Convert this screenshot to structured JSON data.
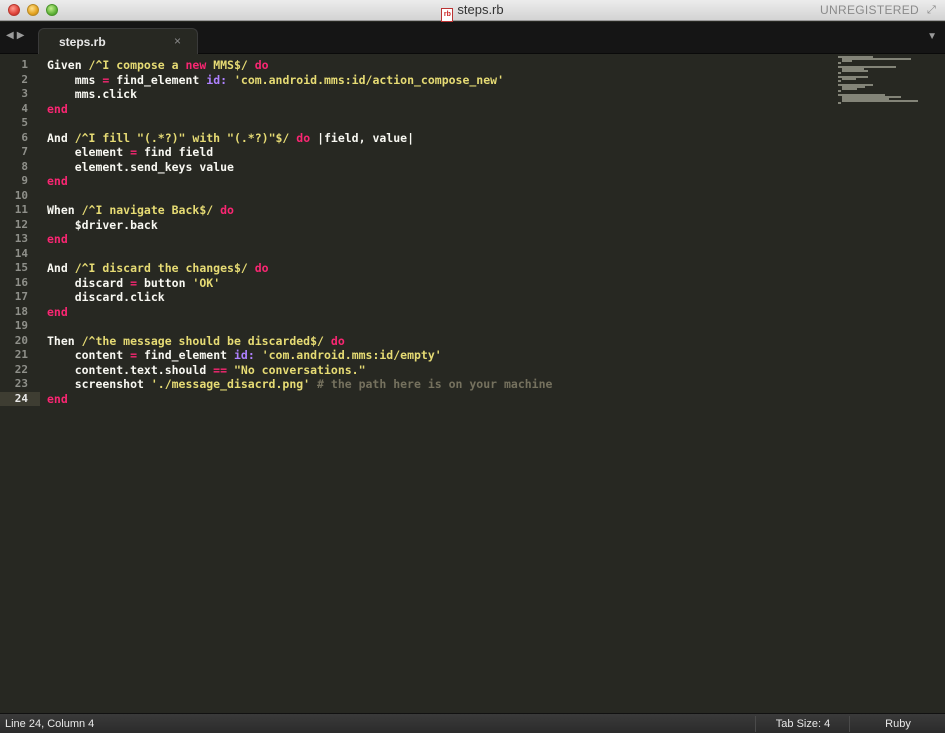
{
  "window": {
    "title": "steps.rb",
    "file_icon_label": "rb",
    "registration": "UNREGISTERED"
  },
  "tabs": [
    {
      "label": "steps.rb",
      "close": "×"
    }
  ],
  "nav": {
    "back": "◀",
    "forward": "▶",
    "dropdown": "▼"
  },
  "editor": {
    "current_line": 24,
    "lines": [
      {
        "n": "1",
        "tokens": [
          [
            "txt",
            "Given "
          ],
          [
            "rx",
            "/^I compose a "
          ],
          [
            "kw",
            "new"
          ],
          [
            "rx",
            " MMS$/"
          ],
          [
            "txt",
            " "
          ],
          [
            "kw",
            "do"
          ]
        ]
      },
      {
        "n": "2",
        "tokens": [
          [
            "txt",
            "    mms "
          ],
          [
            "kw",
            "="
          ],
          [
            "txt",
            " find_element "
          ],
          [
            "sym",
            "id:"
          ],
          [
            "txt",
            " "
          ],
          [
            "str",
            "'com.android.mms:id/action_compose_new'"
          ]
        ]
      },
      {
        "n": "3",
        "tokens": [
          [
            "txt",
            "    mms.click"
          ]
        ]
      },
      {
        "n": "4",
        "tokens": [
          [
            "kw",
            "end"
          ]
        ]
      },
      {
        "n": "5",
        "tokens": []
      },
      {
        "n": "6",
        "tokens": [
          [
            "txt",
            "And "
          ],
          [
            "rx",
            "/^I fill \"(.*?)\" with \"(.*?)\"$/"
          ],
          [
            "txt",
            " "
          ],
          [
            "kw",
            "do"
          ],
          [
            "txt",
            " |field, value|"
          ]
        ]
      },
      {
        "n": "7",
        "tokens": [
          [
            "txt",
            "    element "
          ],
          [
            "kw",
            "="
          ],
          [
            "txt",
            " find field"
          ]
        ]
      },
      {
        "n": "8",
        "tokens": [
          [
            "txt",
            "    element.send_keys value"
          ]
        ]
      },
      {
        "n": "9",
        "tokens": [
          [
            "kw",
            "end"
          ]
        ]
      },
      {
        "n": "10",
        "tokens": []
      },
      {
        "n": "11",
        "tokens": [
          [
            "txt",
            "When "
          ],
          [
            "rx",
            "/^I navigate Back$/"
          ],
          [
            "txt",
            " "
          ],
          [
            "kw",
            "do"
          ]
        ]
      },
      {
        "n": "12",
        "tokens": [
          [
            "txt",
            "    $driver.back"
          ]
        ]
      },
      {
        "n": "13",
        "tokens": [
          [
            "kw",
            "end"
          ]
        ]
      },
      {
        "n": "14",
        "tokens": []
      },
      {
        "n": "15",
        "tokens": [
          [
            "txt",
            "And "
          ],
          [
            "rx",
            "/^I discard the changes$/"
          ],
          [
            "txt",
            " "
          ],
          [
            "kw",
            "do"
          ]
        ]
      },
      {
        "n": "16",
        "tokens": [
          [
            "txt",
            "    discard "
          ],
          [
            "kw",
            "="
          ],
          [
            "txt",
            " button "
          ],
          [
            "str",
            "'OK'"
          ]
        ]
      },
      {
        "n": "17",
        "tokens": [
          [
            "txt",
            "    discard.click"
          ]
        ]
      },
      {
        "n": "18",
        "tokens": [
          [
            "kw",
            "end"
          ]
        ]
      },
      {
        "n": "19",
        "tokens": []
      },
      {
        "n": "20",
        "tokens": [
          [
            "txt",
            "Then "
          ],
          [
            "rx",
            "/^the message should be discarded$/"
          ],
          [
            "txt",
            " "
          ],
          [
            "kw",
            "do"
          ]
        ]
      },
      {
        "n": "21",
        "tokens": [
          [
            "txt",
            "    content "
          ],
          [
            "kw",
            "="
          ],
          [
            "txt",
            " find_element "
          ],
          [
            "sym",
            "id:"
          ],
          [
            "txt",
            " "
          ],
          [
            "str",
            "'com.android.mms:id/empty'"
          ]
        ]
      },
      {
        "n": "22",
        "tokens": [
          [
            "txt",
            "    content.text.should "
          ],
          [
            "kw",
            "=="
          ],
          [
            "txt",
            " "
          ],
          [
            "str",
            "\"No conversations.\""
          ]
        ]
      },
      {
        "n": "23",
        "tokens": [
          [
            "txt",
            "    screenshot "
          ],
          [
            "str",
            "'./message_disacrd.png'"
          ],
          [
            "txt",
            " "
          ],
          [
            "cm",
            "# the path here is on your machine"
          ]
        ]
      },
      {
        "n": "24",
        "tokens": [
          [
            "kw",
            "end"
          ]
        ]
      }
    ]
  },
  "status": {
    "position": "Line 24, Column 4",
    "tab_size": "Tab Size: 4",
    "syntax": "Ruby"
  },
  "colors": {
    "background": "#272822",
    "keyword": "#f92672",
    "string": "#e6db74",
    "symbol": "#ae81ff",
    "comment": "#75715e",
    "text": "#f8f8f2"
  }
}
